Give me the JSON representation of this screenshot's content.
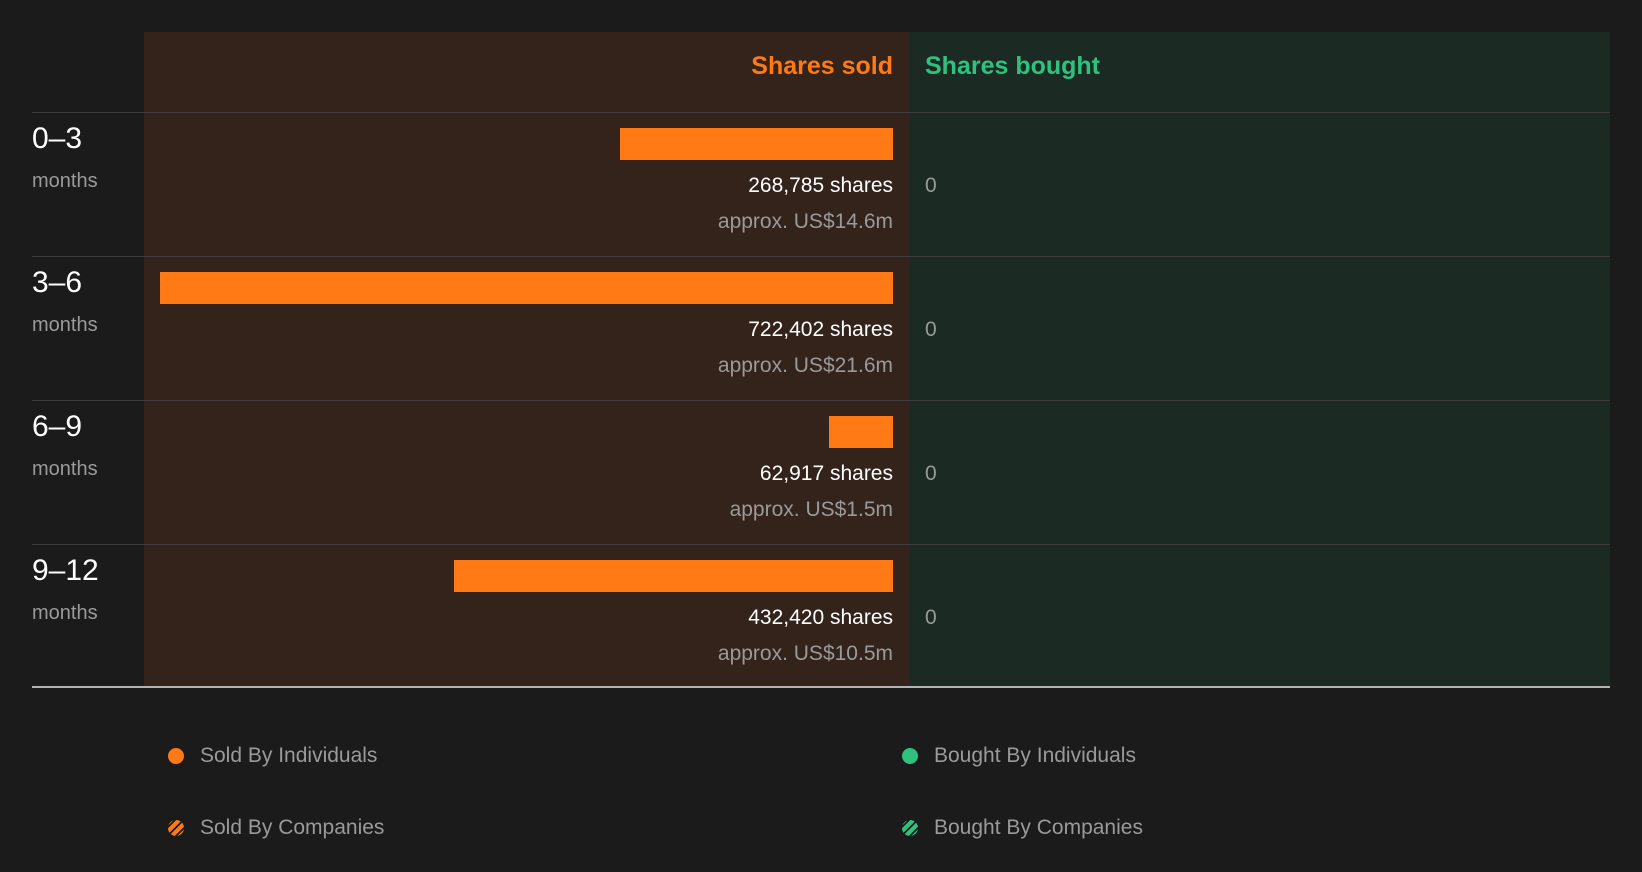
{
  "colors": {
    "sold": "#ff7a15",
    "bought": "#2ec27e",
    "sold_bg": "#33231b",
    "bought_bg": "#1c2a24",
    "background": "#1b1b1b"
  },
  "chart_data": {
    "type": "bar",
    "orientation": "horizontal",
    "headers": {
      "sold": "Shares sold",
      "bought": "Shares bought"
    },
    "categories": [
      "0-3 months",
      "3-6 months",
      "6-9 months",
      "9-12 months"
    ],
    "rows": [
      {
        "range": "0–3",
        "unit": "months",
        "sold_shares": 268785,
        "sold_label": "268,785 shares",
        "sold_value": "approx. US$14.6m",
        "bought_label": "0"
      },
      {
        "range": "3–6",
        "unit": "months",
        "sold_shares": 722402,
        "sold_label": "722,402 shares",
        "sold_value": "approx. US$21.6m",
        "bought_label": "0"
      },
      {
        "range": "6–9",
        "unit": "months",
        "sold_shares": 62917,
        "sold_label": "62,917 shares",
        "sold_value": "approx. US$1.5m",
        "bought_label": "0"
      },
      {
        "range": "9–12",
        "unit": "months",
        "sold_shares": 432420,
        "sold_label": "432,420 shares",
        "sold_value": "approx. US$10.5m",
        "bought_label": "0"
      }
    ],
    "series": [
      {
        "name": "Sold By Individuals",
        "values": [
          268785,
          722402,
          62917,
          432420
        ]
      },
      {
        "name": "Bought By Individuals",
        "values": [
          0,
          0,
          0,
          0
        ]
      }
    ],
    "legend": [
      {
        "label": "Sold By Individuals",
        "swatch": "solid",
        "color": "#ff7a15"
      },
      {
        "label": "Bought By Individuals",
        "swatch": "solid",
        "color": "#2ec27e"
      },
      {
        "label": "Sold By Companies",
        "swatch": "hatched",
        "color": "#ff7a15"
      },
      {
        "label": "Bought By Companies",
        "swatch": "hatched",
        "color": "#2ec27e"
      }
    ],
    "legend_position": "bottom"
  }
}
